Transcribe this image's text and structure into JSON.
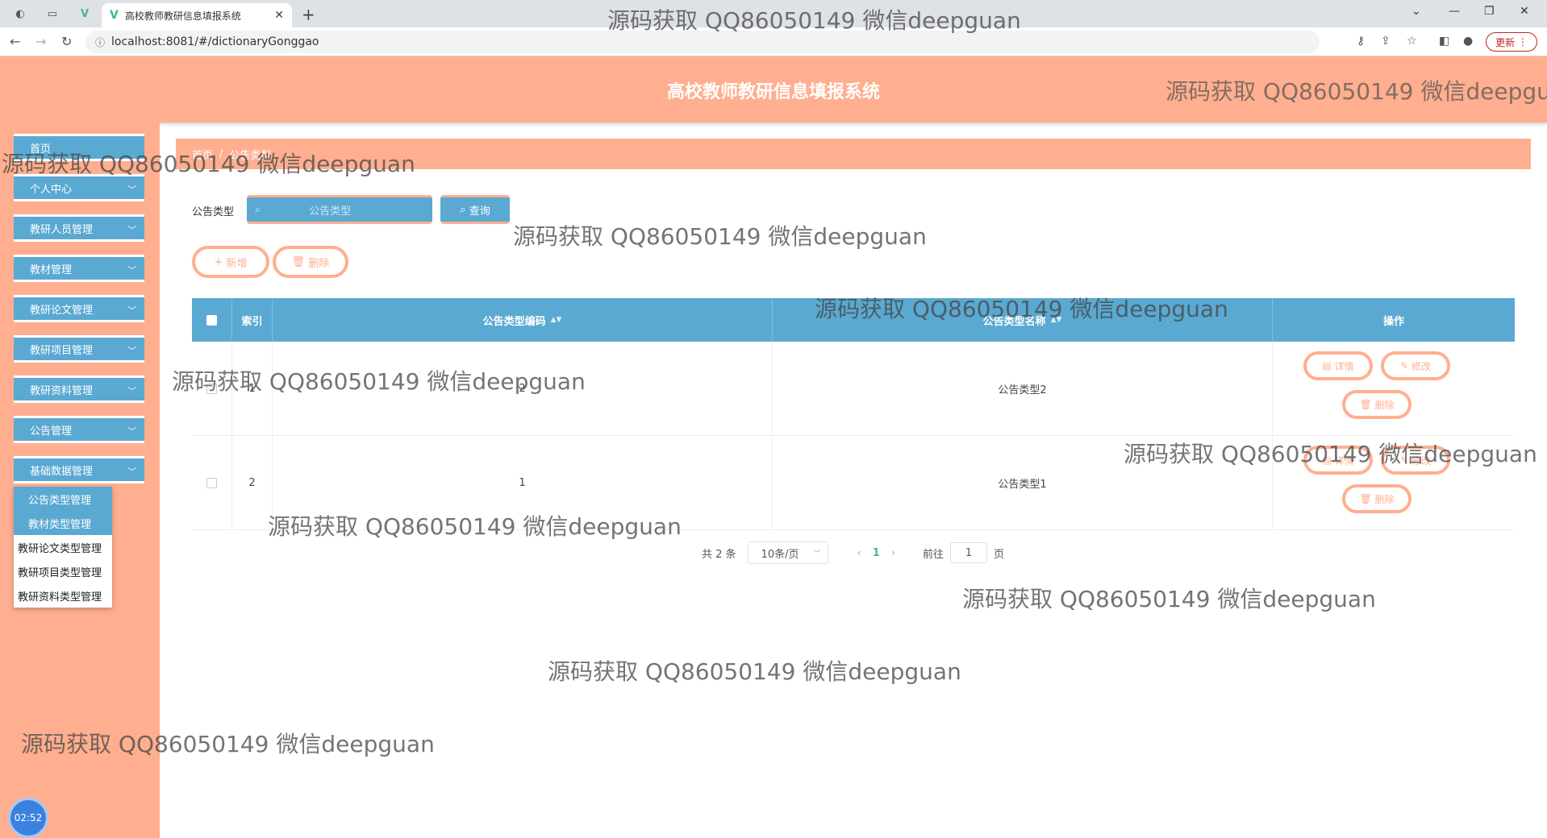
{
  "browser": {
    "tab_title": "高校教师教研信息填报系统",
    "url": "localhost:8081/#/dictionaryGonggao",
    "update_label": "更新"
  },
  "header": {
    "title": "高校教师教研信息填报系统"
  },
  "sidebar": {
    "items": [
      {
        "label": "首页"
      },
      {
        "label": "个人中心"
      },
      {
        "label": "教研人员管理"
      },
      {
        "label": "教材管理"
      },
      {
        "label": "教研论文管理"
      },
      {
        "label": "教研项目管理"
      },
      {
        "label": "教研资料管理"
      },
      {
        "label": "公告管理"
      },
      {
        "label": "基础数据管理"
      }
    ],
    "submenu": [
      {
        "label": "公告类型管理"
      },
      {
        "label": "教材类型管理"
      },
      {
        "label": "教研论文类型管理"
      },
      {
        "label": "教研项目类型管理"
      },
      {
        "label": "教研资料类型管理"
      }
    ],
    "clock": "02:52"
  },
  "breadcrumb": {
    "home": "首页",
    "sep": "/",
    "current": "公告类型"
  },
  "search": {
    "label": "公告类型",
    "placeholder": "公告类型",
    "query_label": "查询"
  },
  "actions": {
    "add_label": "新增",
    "delete_label": "删除"
  },
  "table": {
    "headers": {
      "index": "索引",
      "code": "公告类型编码",
      "name": "公告类型名称",
      "ops": "操作"
    },
    "rows": [
      {
        "index": "1",
        "code": "2",
        "name": "公告类型2"
      },
      {
        "index": "2",
        "code": "1",
        "name": "公告类型1"
      }
    ],
    "op_labels": {
      "detail": "详情",
      "edit": "修改",
      "delete": "删除"
    }
  },
  "pagination": {
    "total": "共 2 条",
    "page_size": "10条/页",
    "current_page": "1",
    "goto_label": "前往",
    "goto_value": "1",
    "page_suffix": "页"
  },
  "watermark": "源码获取 QQ86050149 微信deepguan"
}
